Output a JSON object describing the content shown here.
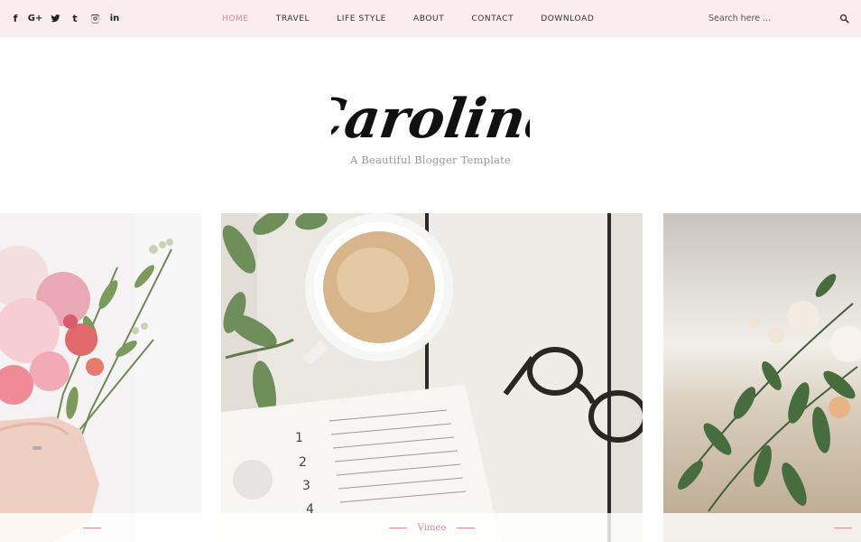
{
  "social": [
    {
      "icon": "facebook-icon",
      "glyph": "f"
    },
    {
      "icon": "google-plus-icon",
      "glyph": "G+"
    },
    {
      "icon": "twitter-icon",
      "glyph": ""
    },
    {
      "icon": "tumblr-icon",
      "glyph": "t"
    },
    {
      "icon": "instagram-icon",
      "glyph": ""
    },
    {
      "icon": "linkedin-icon",
      "glyph": "in"
    }
  ],
  "nav": {
    "items": [
      {
        "label": "HOME",
        "active": true
      },
      {
        "label": "TRAVEL",
        "active": false
      },
      {
        "label": "LIFE STYLE",
        "active": false
      },
      {
        "label": "ABOUT",
        "active": false
      },
      {
        "label": "CONTACT",
        "active": false
      },
      {
        "label": "DOWNLOAD",
        "active": false
      }
    ]
  },
  "search": {
    "placeholder": "Search here ..."
  },
  "header": {
    "logo_text": "Carolina",
    "tagline": "A Beautiful Blogger Template"
  },
  "slider": {
    "slides": [
      {
        "image": "pink-flower-bouquet",
        "caption": ""
      },
      {
        "image": "coffee-calendar-glasses",
        "caption": "Vimeo"
      },
      {
        "image": "white-flowers-greenery",
        "caption": ""
      }
    ]
  },
  "colors": {
    "topbar_bg": "#f9ecec",
    "accent": "#d98a92",
    "text": "#333333"
  }
}
